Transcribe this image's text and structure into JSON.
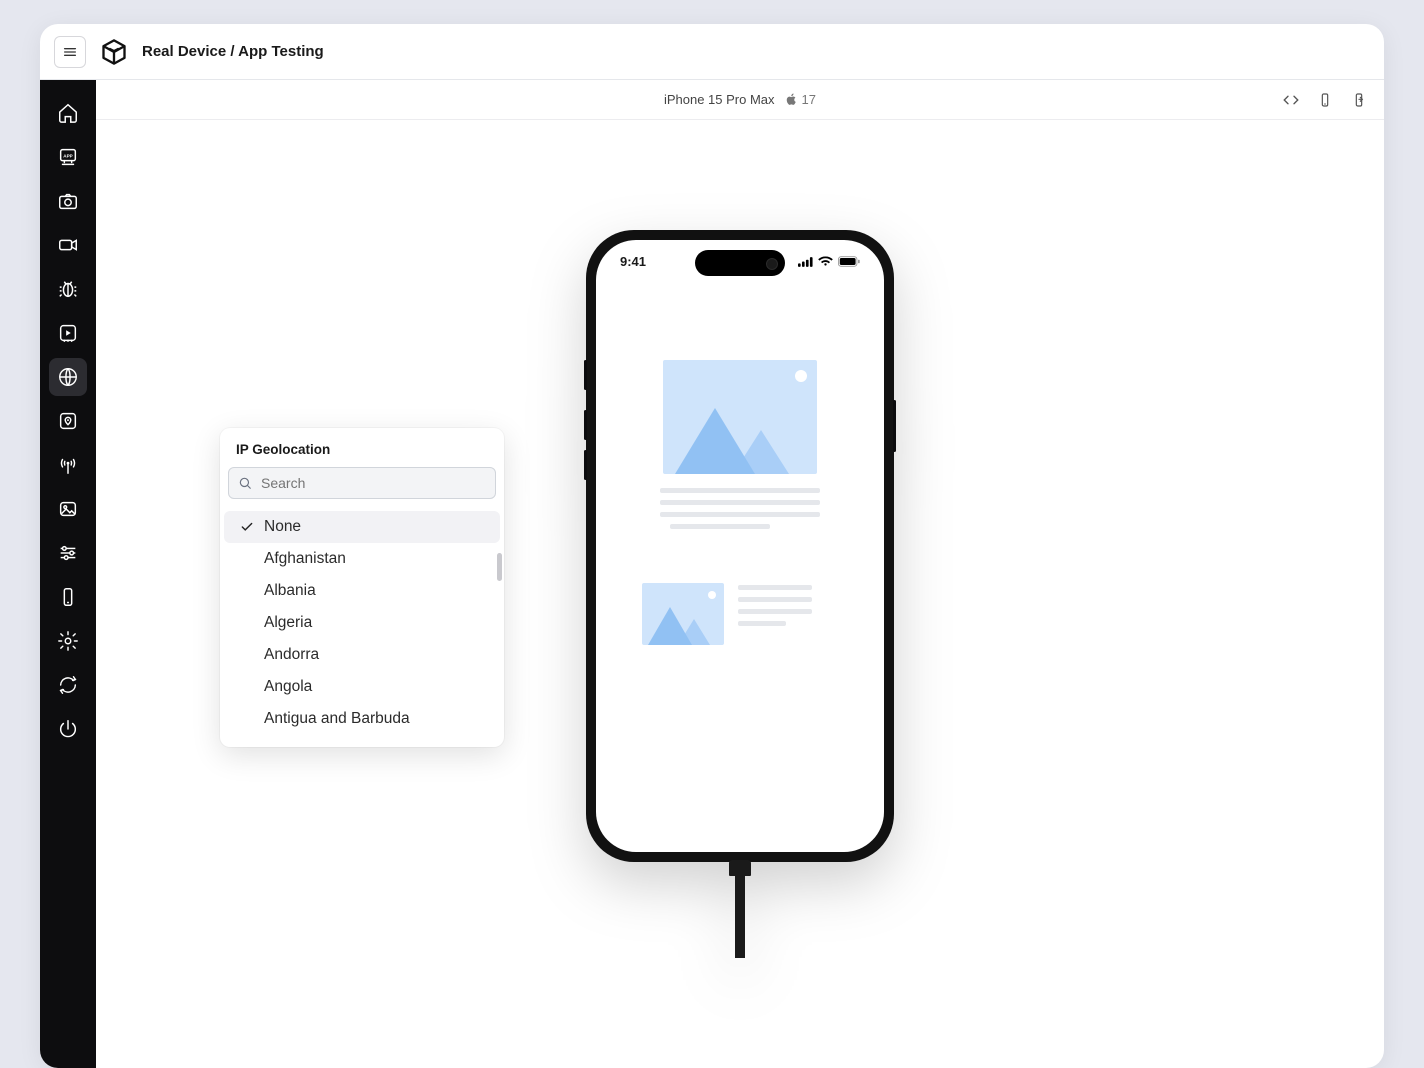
{
  "header": {
    "title": "Real Device / App Testing"
  },
  "sidebar": {
    "items": [
      {
        "name": "home"
      },
      {
        "name": "app"
      },
      {
        "name": "camera"
      },
      {
        "name": "video"
      },
      {
        "name": "bug"
      },
      {
        "name": "playback"
      },
      {
        "name": "globe",
        "active": true
      },
      {
        "name": "map-pin"
      },
      {
        "name": "antenna"
      },
      {
        "name": "image"
      },
      {
        "name": "sliders"
      },
      {
        "name": "device"
      },
      {
        "name": "settings"
      },
      {
        "name": "sync"
      },
      {
        "name": "power"
      }
    ]
  },
  "deviceBar": {
    "label": "iPhone 15 Pro Max",
    "os": "17"
  },
  "popover": {
    "title": "IP Geolocation",
    "search_placeholder": "Search",
    "items": [
      {
        "label": "None",
        "selected": true
      },
      {
        "label": "Afghanistan"
      },
      {
        "label": "Albania"
      },
      {
        "label": "Algeria"
      },
      {
        "label": "Andorra"
      },
      {
        "label": "Angola"
      },
      {
        "label": "Antigua and Barbuda"
      }
    ]
  },
  "phone": {
    "time": "9:41"
  }
}
